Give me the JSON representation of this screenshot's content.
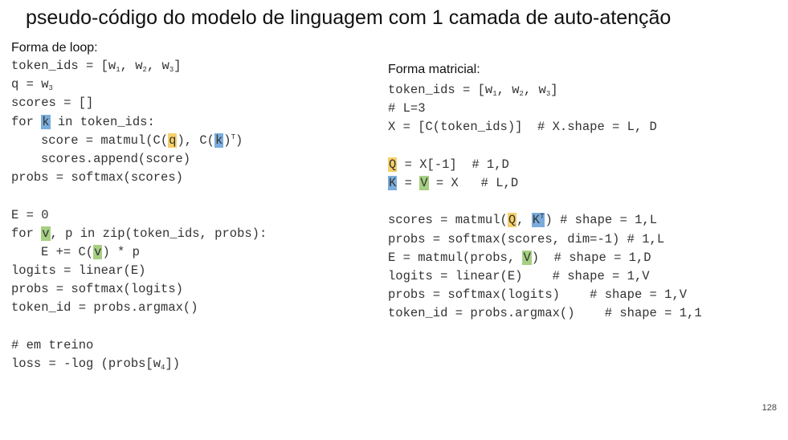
{
  "title": "pseudo-código do modelo de linguagem com 1 camada de auto-atenção",
  "left": {
    "heading": "Forma de loop:",
    "code": {
      "l1_a": "token_ids = [w",
      "l1_s1": "1",
      "l1_b": ", w",
      "l1_s2": "2",
      "l1_c": ", w",
      "l1_s3": "3",
      "l1_d": "]",
      "l2_a": "q = w",
      "l2_s": "3",
      "l3": "scores = []",
      "l4_a": "for ",
      "l4_k": "k",
      "l4_b": " in token_ids:",
      "l5_a": "score = matmul(C(",
      "l5_q": "q",
      "l5_b": "), C(",
      "l5_k": "k",
      "l5_c": ")",
      "l5_t": "T",
      "l5_d": ")",
      "l6": "scores.append(score)",
      "l7": "probs = softmax(scores)",
      "l8": "E = 0",
      "l9_a": "for ",
      "l9_v": "v",
      "l9_b": ", p in zip(token_ids, probs):",
      "l10_a": "E += C(",
      "l10_v": "v",
      "l10_b": ") * p",
      "l11": "logits = linear(E)",
      "l12": "probs = softmax(logits)",
      "l13": "token_id = probs.argmax()",
      "l14": "# em treino",
      "l15_a": "loss = -log (probs[w",
      "l15_s": "4",
      "l15_b": "])"
    }
  },
  "right": {
    "heading": "Forma matricial:",
    "code": {
      "r1_a": "token_ids = [w",
      "r1_s1": "1",
      "r1_b": ", w",
      "r1_s2": "2",
      "r1_c": ", w",
      "r1_s3": "3",
      "r1_d": "]",
      "r2": "# L=3",
      "r3": "X = [C(token_ids)]  # X.shape = L, D",
      "r4_q": "Q",
      "r4_b": " = X[-1]  # 1,D",
      "r5_k": "K",
      "r5_b": " = ",
      "r5_v": "V",
      "r5_c": " = X   # L,D",
      "r6_a": "scores = matmul(",
      "r6_q": "Q",
      "r6_b": ", ",
      "r6_k": "K",
      "r6_t": "T",
      "r6_c": ") # shape = 1,L",
      "r7": "probs = softmax(scores, dim=-1) # 1,L",
      "r8_a": "E = matmul(probs, ",
      "r8_v": "V",
      "r8_b": ")  # shape = 1,D",
      "r9": "logits = linear(E)    # shape = 1,V",
      "r10": "probs = softmax(logits)    # shape = 1,V",
      "r11": "token_id = probs.argmax()    # shape = 1,1"
    }
  },
  "page_number": "128",
  "highlight_colors": {
    "query": "#f6d06a",
    "key": "#7aaddc",
    "value": "#a6cf83"
  }
}
